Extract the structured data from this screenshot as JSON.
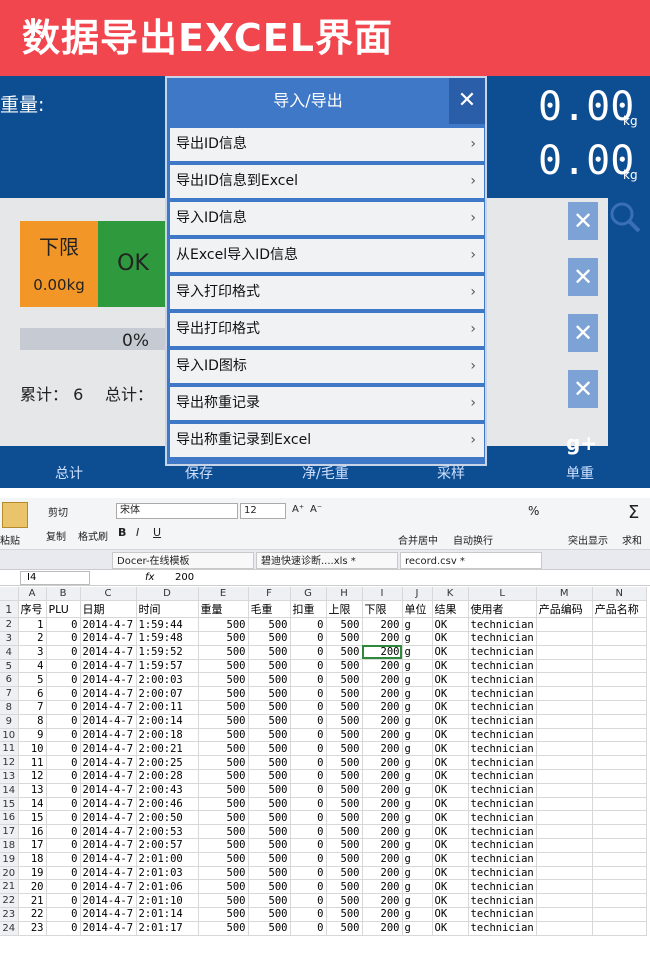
{
  "banner": {
    "title": "数据导出EXCEL界面"
  },
  "device": {
    "weight_label": "重量:",
    "value_top": "0.00",
    "value_bottom": "0.00",
    "unit": "kg",
    "limit_title": "下限",
    "limit_value": "0.00kg",
    "ok_label": "OK",
    "progress_text": "0%",
    "progress": 0,
    "cumulative": "累计：  6",
    "total": "总计：",
    "x_glyph": "✕",
    "bottom": {
      "b1": "总计",
      "b2": "保存",
      "b3": "净/毛重",
      "b4": "采样",
      "b5": "单重",
      "gplus": "g+"
    },
    "dialog": {
      "title": "导入/导出",
      "close": "✕",
      "arrow": "›",
      "items": [
        "导出ID信息",
        "导出ID信息到Excel",
        "导入ID信息",
        "从Excel导入ID信息",
        "导入打印格式",
        "导出打印格式",
        "导入ID图标",
        "导出称重记录",
        "导出称重记录到Excel"
      ]
    }
  },
  "excel": {
    "ribbon": {
      "paste": "粘贴",
      "cut": "剪切",
      "copy": "复制",
      "format_painter": "格式刷",
      "font": "宋体",
      "size": "12",
      "bold": "B",
      "italic": "I",
      "underline": "U",
      "merge": "合并居中",
      "wrap": "自动换行",
      "highlight": "突出显示",
      "sum": "求和",
      "grow": "A⁺",
      "shrink": "A⁻",
      "percent": "%",
      "sigma": "Σ"
    },
    "tabs": [
      "Docer-在线模板",
      "碧迪快速诊断....xls *",
      "record.csv *"
    ],
    "name_box": "I4",
    "fx": "fx",
    "formula": "200",
    "col_letters": [
      "A",
      "B",
      "C",
      "D",
      "E",
      "F",
      "G",
      "H",
      "I",
      "J",
      "K",
      "L",
      "M",
      "N"
    ],
    "headers": [
      "序号",
      "PLU",
      "日期",
      "时间",
      "重量",
      "毛重",
      "扣重",
      "上限",
      "下限",
      "单位",
      "结果",
      "使用者",
      "产品编码",
      "产品名称"
    ],
    "rows": [
      [
        "1",
        "0",
        "2014-4-7",
        "1:59:44",
        "500",
        "500",
        "0",
        "500",
        "200",
        "g",
        "OK",
        "technician"
      ],
      [
        "2",
        "0",
        "2014-4-7",
        "1:59:48",
        "500",
        "500",
        "0",
        "500",
        "200",
        "g",
        "OK",
        "technician"
      ],
      [
        "3",
        "0",
        "2014-4-7",
        "1:59:52",
        "500",
        "500",
        "0",
        "500",
        "200",
        "g",
        "OK",
        "technician"
      ],
      [
        "4",
        "0",
        "2014-4-7",
        "1:59:57",
        "500",
        "500",
        "0",
        "500",
        "200",
        "g",
        "OK",
        "technician"
      ],
      [
        "5",
        "0",
        "2014-4-7",
        "2:00:03",
        "500",
        "500",
        "0",
        "500",
        "200",
        "g",
        "OK",
        "technician"
      ],
      [
        "6",
        "0",
        "2014-4-7",
        "2:00:07",
        "500",
        "500",
        "0",
        "500",
        "200",
        "g",
        "OK",
        "technician"
      ],
      [
        "7",
        "0",
        "2014-4-7",
        "2:00:11",
        "500",
        "500",
        "0",
        "500",
        "200",
        "g",
        "OK",
        "technician"
      ],
      [
        "8",
        "0",
        "2014-4-7",
        "2:00:14",
        "500",
        "500",
        "0",
        "500",
        "200",
        "g",
        "OK",
        "technician"
      ],
      [
        "9",
        "0",
        "2014-4-7",
        "2:00:18",
        "500",
        "500",
        "0",
        "500",
        "200",
        "g",
        "OK",
        "technician"
      ],
      [
        "10",
        "0",
        "2014-4-7",
        "2:00:21",
        "500",
        "500",
        "0",
        "500",
        "200",
        "g",
        "OK",
        "technician"
      ],
      [
        "11",
        "0",
        "2014-4-7",
        "2:00:25",
        "500",
        "500",
        "0",
        "500",
        "200",
        "g",
        "OK",
        "technician"
      ],
      [
        "12",
        "0",
        "2014-4-7",
        "2:00:28",
        "500",
        "500",
        "0",
        "500",
        "200",
        "g",
        "OK",
        "technician"
      ],
      [
        "13",
        "0",
        "2014-4-7",
        "2:00:43",
        "500",
        "500",
        "0",
        "500",
        "200",
        "g",
        "OK",
        "technician"
      ],
      [
        "14",
        "0",
        "2014-4-7",
        "2:00:46",
        "500",
        "500",
        "0",
        "500",
        "200",
        "g",
        "OK",
        "technician"
      ],
      [
        "15",
        "0",
        "2014-4-7",
        "2:00:50",
        "500",
        "500",
        "0",
        "500",
        "200",
        "g",
        "OK",
        "technician"
      ],
      [
        "16",
        "0",
        "2014-4-7",
        "2:00:53",
        "500",
        "500",
        "0",
        "500",
        "200",
        "g",
        "OK",
        "technician"
      ],
      [
        "17",
        "0",
        "2014-4-7",
        "2:00:57",
        "500",
        "500",
        "0",
        "500",
        "200",
        "g",
        "OK",
        "technician"
      ],
      [
        "18",
        "0",
        "2014-4-7",
        "2:01:00",
        "500",
        "500",
        "0",
        "500",
        "200",
        "g",
        "OK",
        "technician"
      ],
      [
        "19",
        "0",
        "2014-4-7",
        "2:01:03",
        "500",
        "500",
        "0",
        "500",
        "200",
        "g",
        "OK",
        "technician"
      ],
      [
        "20",
        "0",
        "2014-4-7",
        "2:01:06",
        "500",
        "500",
        "0",
        "500",
        "200",
        "g",
        "OK",
        "technician"
      ],
      [
        "21",
        "0",
        "2014-4-7",
        "2:01:10",
        "500",
        "500",
        "0",
        "500",
        "200",
        "g",
        "OK",
        "technician"
      ],
      [
        "22",
        "0",
        "2014-4-7",
        "2:01:14",
        "500",
        "500",
        "0",
        "500",
        "200",
        "g",
        "OK",
        "technician"
      ],
      [
        "23",
        "0",
        "2014-4-7",
        "2:01:17",
        "500",
        "500",
        "0",
        "500",
        "200",
        "g",
        "OK",
        "technician"
      ]
    ]
  }
}
